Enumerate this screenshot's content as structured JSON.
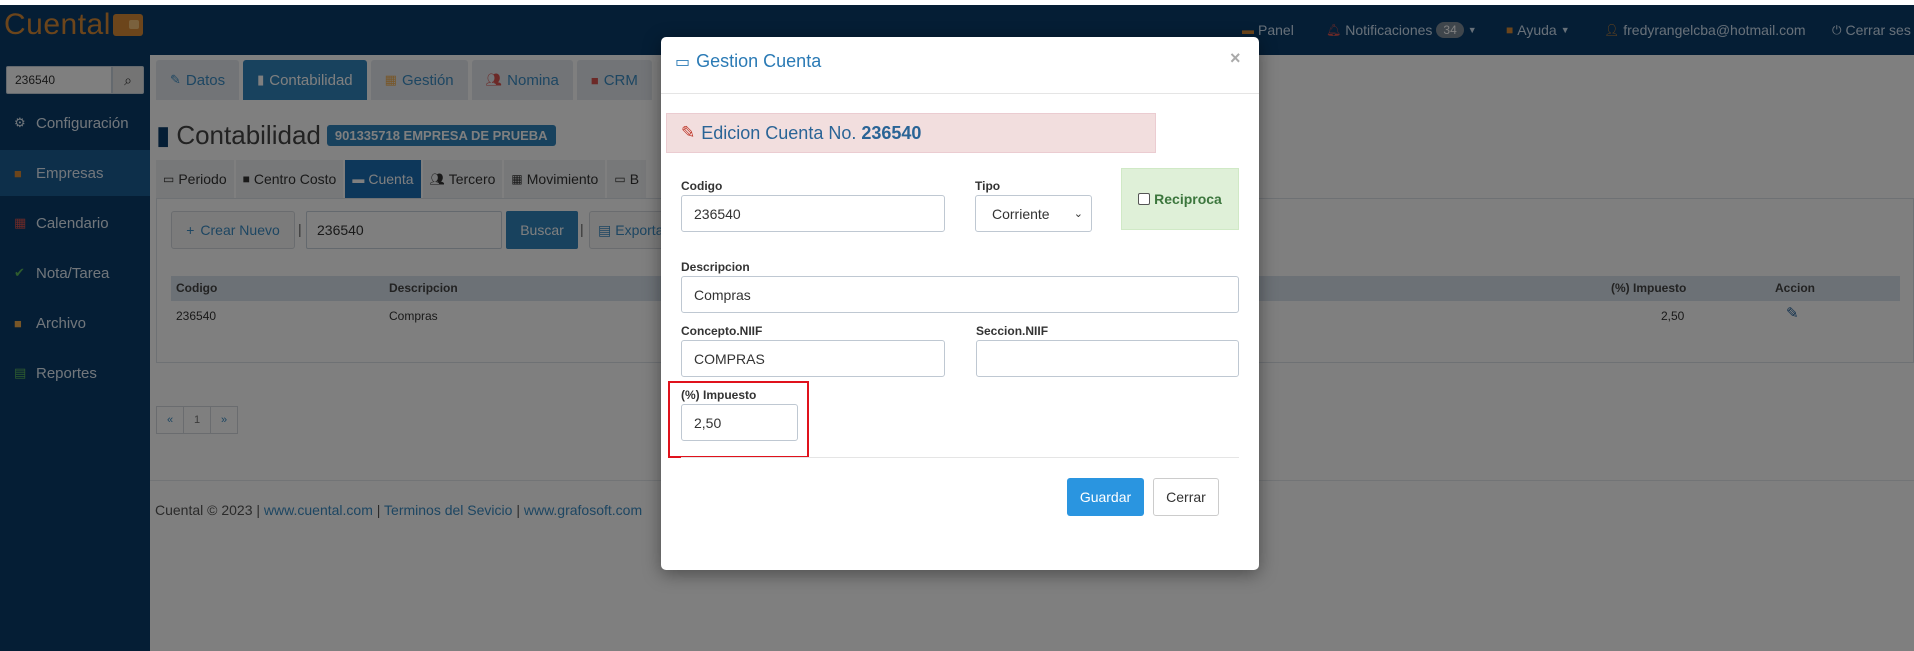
{
  "brand": {
    "name": "Cuental"
  },
  "topnav": {
    "panel": "Panel",
    "notifications": "Notificaciones",
    "notifications_count": "34",
    "help": "Ayuda",
    "user": "fredyrangelcba@hotmail.com",
    "logout": "Cerrar ses"
  },
  "sidebar": {
    "search_value": "236540",
    "items": [
      {
        "label": "Configuración",
        "icon": "gear-icon"
      },
      {
        "label": "Empresas",
        "icon": "briefcase-icon"
      },
      {
        "label": "Calendario",
        "icon": "calendar-icon"
      },
      {
        "label": "Nota/Tarea",
        "icon": "check-circle-icon"
      },
      {
        "label": "Archivo",
        "icon": "folder-icon"
      },
      {
        "label": "Reportes",
        "icon": "printer-icon"
      }
    ]
  },
  "module_tabs": [
    "Datos",
    "Contabilidad",
    "Gestión",
    "Nomina",
    "CRM"
  ],
  "page": {
    "title": "Contabilidad",
    "company": "901335718 EMPRESA DE PRUEBA"
  },
  "sub_tabs": [
    "Periodo",
    "Centro Costo",
    "Cuenta",
    "Tercero",
    "Movimiento",
    "B"
  ],
  "toolbar": {
    "new_label": "Crear Nuevo",
    "filter_value": "236540",
    "search_label": "Buscar",
    "export_label": "Exporta"
  },
  "table": {
    "headers": {
      "codigo": "Codigo",
      "descripcion": "Descripcion",
      "impuesto": "(%) Impuesto",
      "accion": "Accion"
    },
    "rows": [
      {
        "codigo": "236540",
        "descripcion": "Compras",
        "impuesto": "2,50"
      }
    ]
  },
  "pager": {
    "prev": "«",
    "page": "1",
    "next": "»"
  },
  "footer": {
    "copyright": "Cuental © 2023 |",
    "link1": "www.cuental.com",
    "sep1": "|",
    "link2": "Terminos del Sevicio",
    "sep2": "|",
    "link3": "www.grafosoft.com"
  },
  "modal": {
    "title": "Gestion Cuenta",
    "edit_prefix": "Edicion Cuenta No.",
    "edit_number": "236540",
    "labels": {
      "codigo": "Codigo",
      "tipo": "Tipo",
      "reciproca": "Reciproca",
      "descripcion": "Descripcion",
      "concepto": "Concepto.NIIF",
      "seccion": "Seccion.NIIF",
      "impuesto": "(%) Impuesto"
    },
    "values": {
      "codigo": "236540",
      "tipo": "Corriente",
      "descripcion": "Compras",
      "concepto": "COMPRAS",
      "seccion": "",
      "impuesto": "2,50"
    },
    "save_label": "Guardar",
    "close_label": "Cerrar"
  }
}
